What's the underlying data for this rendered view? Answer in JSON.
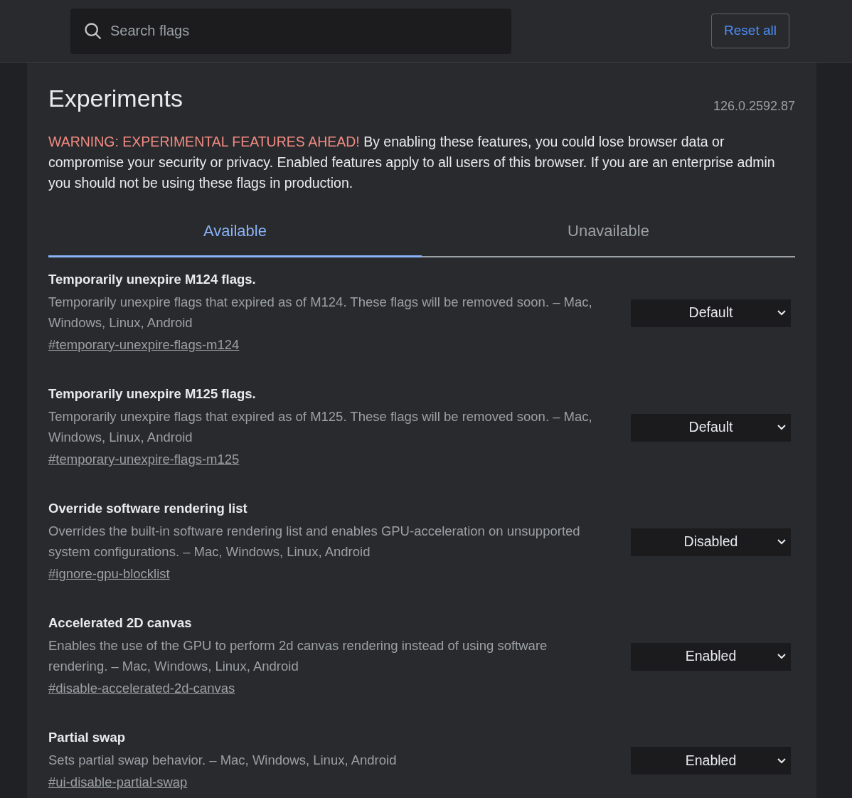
{
  "search": {
    "placeholder": "Search flags"
  },
  "reset_button": "Reset all",
  "title": "Experiments",
  "version": "126.0.2592.87",
  "warning": {
    "label": "WARNING: EXPERIMENTAL FEATURES AHEAD!",
    "text": "By enabling these features, you could lose browser data or compromise your security or privacy. Enabled features apply to all users of this browser. If you are an enterprise admin you should not be using these flags in production."
  },
  "tabs": [
    {
      "label": "Available",
      "selected": true
    },
    {
      "label": "Unavailable",
      "selected": false
    }
  ],
  "flags": [
    {
      "title": "Temporarily unexpire M124 flags.",
      "description": "Temporarily unexpire flags that expired as of M124. These flags will be removed soon. – Mac, Windows, Linux, Android",
      "link": "#temporary-unexpire-flags-m124",
      "value": "Default"
    },
    {
      "title": "Temporarily unexpire M125 flags.",
      "description": "Temporarily unexpire flags that expired as of M125. These flags will be removed soon. – Mac, Windows, Linux, Android",
      "link": "#temporary-unexpire-flags-m125",
      "value": "Default"
    },
    {
      "title": "Override software rendering list",
      "description": "Overrides the built-in software rendering list and enables GPU-acceleration on unsupported system configurations. – Mac, Windows, Linux, Android",
      "link": "#ignore-gpu-blocklist",
      "value": "Disabled"
    },
    {
      "title": "Accelerated 2D canvas",
      "description": "Enables the use of the GPU to perform 2d canvas rendering instead of using software rendering. – Mac, Windows, Linux, Android",
      "link": "#disable-accelerated-2d-canvas",
      "value": "Enabled"
    },
    {
      "title": "Partial swap",
      "description": "Sets partial swap behavior. – Mac, Windows, Linux, Android",
      "link": "#ui-disable-partial-swap",
      "value": "Enabled"
    }
  ]
}
